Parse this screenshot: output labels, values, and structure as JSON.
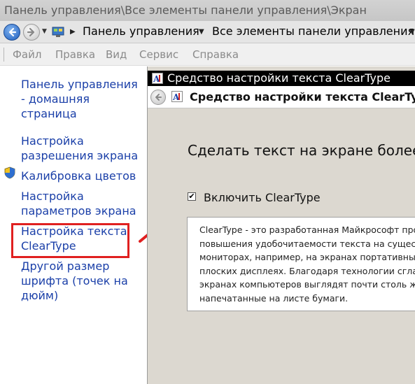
{
  "window": {
    "title": "Панель управления\\Все элементы панели управления\\Экран"
  },
  "address_bar": {
    "crumbs": [
      "Панель управления",
      "Все элементы панели управления"
    ]
  },
  "menu": {
    "items": [
      "Файл",
      "Правка",
      "Вид",
      "Сервис",
      "Справка"
    ]
  },
  "sidebar": {
    "links": [
      {
        "lines": [
          "Панель управления",
          "- домашняя",
          "страница"
        ]
      },
      {
        "lines": [
          "Настройка",
          "разрешения экрана"
        ]
      },
      {
        "lines": [
          "Калибровка цветов"
        ],
        "icon": "shield-icon"
      },
      {
        "lines": [
          "Настройка",
          "параметров экрана"
        ]
      },
      {
        "lines": [
          "Настройка текста",
          "ClearType"
        ],
        "highlighted": true
      },
      {
        "lines": [
          "Другой размер",
          "шрифта (точек на",
          "дюйм)"
        ]
      }
    ]
  },
  "cleartype": {
    "window_title": "Средство настройки текста ClearType",
    "nav_title": "Средство настройки текста ClearType",
    "heading": "Сделать текст на экране более у",
    "checkbox_label": "Включить ClearType",
    "checkbox_checked": true,
    "description_lines": [
      "ClearType - это разработанная Майкрософт прогр",
      "повышения удобочитаемости текста на существу",
      "мониторах, например, на экранах портативных",
      "плоских дисплеях. Благодаря технологии сглажи",
      "экранах компьютеров выглядят почти столь же ч",
      "напечатанные на листе бумаги."
    ]
  },
  "colors": {
    "link": "#1a3fa8",
    "highlight_box": "#e02020",
    "arrow": "#e02020",
    "panel_bg": "#dcd8d0"
  }
}
